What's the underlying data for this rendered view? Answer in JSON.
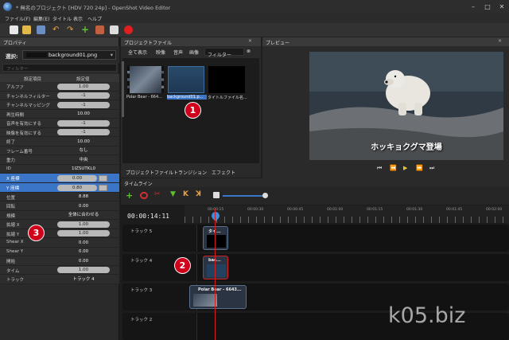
{
  "window": {
    "title": "* 無名のプロジェクト [HDV 720 24p] - OpenShot Video Editor"
  },
  "menu": [
    "ファイル(F)",
    "編集(E)",
    "タイトル",
    "表示",
    "ヘルプ"
  ],
  "properties": {
    "panel_title": "プロパティ",
    "select_label": "選択:",
    "selected_clip": "background01.png",
    "filter_placeholder": "フィルター",
    "col_name": "設定項目",
    "col_value": "設定値",
    "rows": [
      {
        "name": "アルファ",
        "value": "1.00"
      },
      {
        "name": "チャンネルフィルター",
        "value": "-1"
      },
      {
        "name": "チャンネルマッピング",
        "value": "-1"
      },
      {
        "name": "再生時間",
        "value": "10.00"
      },
      {
        "name": "音声を有効にする",
        "value": "-1"
      },
      {
        "name": "映像を有効にする",
        "value": "-1"
      },
      {
        "name": "終了",
        "value": "10.00"
      },
      {
        "name": "フレーム番号",
        "value": "なし"
      },
      {
        "name": "重力",
        "value": "中央"
      },
      {
        "name": "ID",
        "value": "1IZSUTKL0"
      },
      {
        "name": "X 座標",
        "value": "0.00"
      },
      {
        "name": "Y 座標",
        "value": "0.80"
      },
      {
        "name": "位置",
        "value": "8.88"
      },
      {
        "name": "回転",
        "value": "0.00"
      },
      {
        "name": "規模",
        "value": "全体に合わせる"
      },
      {
        "name": "拡縮 X",
        "value": "1.00"
      },
      {
        "name": "拡縮 Y",
        "value": "1.00"
      },
      {
        "name": "Shear X",
        "value": "0.00"
      },
      {
        "name": "Shear Y",
        "value": "0.00"
      },
      {
        "name": "開始",
        "value": "0.00"
      },
      {
        "name": "タイム",
        "value": "1.00"
      },
      {
        "name": "トラック",
        "value": "トラック 4"
      }
    ]
  },
  "project_files": {
    "panel_title": "プロジェクトファイル",
    "tabs": [
      "全て表示",
      "映像",
      "音声",
      "画像"
    ],
    "filter_placeholder": "フィルター",
    "clear": "⊗",
    "files": [
      {
        "label": "Polar Bear - 664..."
      },
      {
        "label": "background01.p..."
      },
      {
        "label": "タイトルファイル名..."
      }
    ]
  },
  "preview": {
    "panel_title": "プレビュー",
    "caption": "ホッキョクグマ登場",
    "controls": [
      "⏮",
      "⏪",
      "▶",
      "⏩",
      "⏭"
    ]
  },
  "bottom_tabs": [
    "プロジェクトファイル",
    "トランジション",
    "エフェクト"
  ],
  "timeline": {
    "title": "タイムライン",
    "timecode": "00:00:14:11",
    "ruler": [
      "00:00:15",
      "00:00:30",
      "00:00:45",
      "00:01:00",
      "00:01:15",
      "00:01:30",
      "00:01:45",
      "00:02:00"
    ],
    "tracks": [
      {
        "name": "トラック 5",
        "clip": "タイ..."
      },
      {
        "name": "トラック 4",
        "clip": "bac..."
      },
      {
        "name": "トラック 3",
        "clip": "Polar Bear - 6643..."
      },
      {
        "name": "トラック 2",
        "clip": ""
      }
    ]
  },
  "badges": [
    "1",
    "2",
    "3"
  ],
  "watermark": "k05.biz",
  "colors": {
    "accent": "#3b75c7",
    "badge": "#d0021b",
    "playhead": "#d02020"
  }
}
